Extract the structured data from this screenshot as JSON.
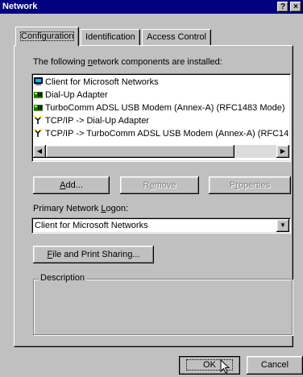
{
  "window": {
    "title": "Network",
    "help_button": "?",
    "close_button": "×"
  },
  "tabs": [
    {
      "label": "Configuration",
      "active": true
    },
    {
      "label": "Identification",
      "active": false
    },
    {
      "label": "Access Control",
      "active": false
    }
  ],
  "components": {
    "heading_pre": "The following ",
    "heading_ul": "n",
    "heading_post": "etwork components are installed:",
    "items": [
      {
        "label": "Client for Microsoft Networks",
        "icon": "client-icon"
      },
      {
        "label": "Dial-Up Adapter",
        "icon": "adapter-icon"
      },
      {
        "label": "TurboComm ADSL USB Modem (Annex-A) (RFC1483 Mode)",
        "icon": "adapter-icon"
      },
      {
        "label": "TCP/IP -> Dial-Up Adapter",
        "icon": "protocol-icon"
      },
      {
        "label": "TCP/IP -> TurboComm ADSL USB Modem (Annex-A) (RFC14",
        "icon": "protocol-icon"
      }
    ],
    "scroll_left": "◀",
    "scroll_right": "▶"
  },
  "buttons": {
    "add_ul": "A",
    "add_rest": "dd...",
    "remove_pre": "R",
    "remove_ul": "e",
    "remove_post": "move",
    "properties_pre": "P",
    "properties_ul": "r",
    "properties_post": "operties"
  },
  "logon": {
    "label_pre": "Primary Network ",
    "label_ul": "L",
    "label_post": "ogon:",
    "value": "Client for Microsoft Networks",
    "arrow": "▼"
  },
  "file_print": {
    "label_ul": "F",
    "label_rest": "ile and Print Sharing..."
  },
  "description": {
    "title": "Description"
  },
  "footer": {
    "ok": "OK",
    "cancel": "Cancel"
  },
  "colors": {
    "titlebar": "#000080",
    "face": "#c0c0c0",
    "shadow": "#808080",
    "highlight": "#ffffff"
  }
}
